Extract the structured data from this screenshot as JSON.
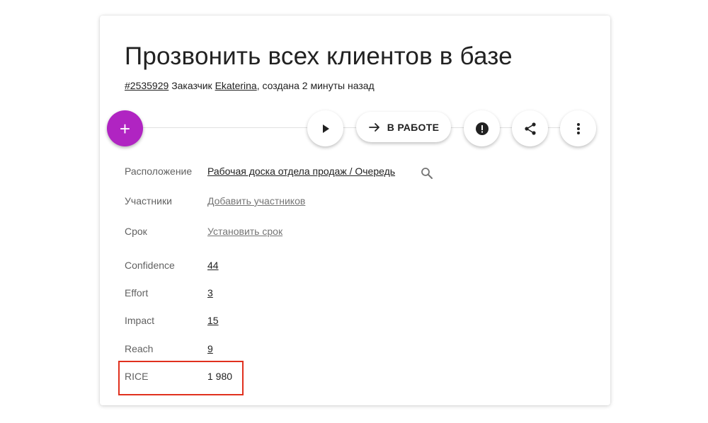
{
  "task": {
    "title": "Прозвонить всех клиентов в базе",
    "id": "#2535929",
    "customer_prefix": "Заказчик",
    "customer": "Ekaterina",
    "created": ", создана 2 минуты назад"
  },
  "toolbar": {
    "add_label": "+",
    "status_label": "В РАБОТЕ"
  },
  "fields": {
    "location": {
      "label": "Расположение",
      "value": "Рабочая доска отдела продаж / Очередь"
    },
    "members": {
      "label": "Участники",
      "value": "Добавить участников"
    },
    "deadline": {
      "label": "Срок",
      "value": "Установить срок"
    },
    "confidence": {
      "label": "Confidence",
      "value": "44"
    },
    "effort": {
      "label": "Effort",
      "value": "3"
    },
    "impact": {
      "label": "Impact",
      "value": "15"
    },
    "reach": {
      "label": "Reach",
      "value": "9"
    },
    "rice": {
      "label": "RICE",
      "value": "1 980"
    }
  },
  "icons": {
    "play": "play-icon",
    "arrow": "arrow-right-icon",
    "alert": "alert-icon",
    "share": "share-icon",
    "more": "more-vert-icon",
    "search": "search-icon"
  },
  "colors": {
    "fab": "#b024c2",
    "highlight": "#e0301e"
  }
}
